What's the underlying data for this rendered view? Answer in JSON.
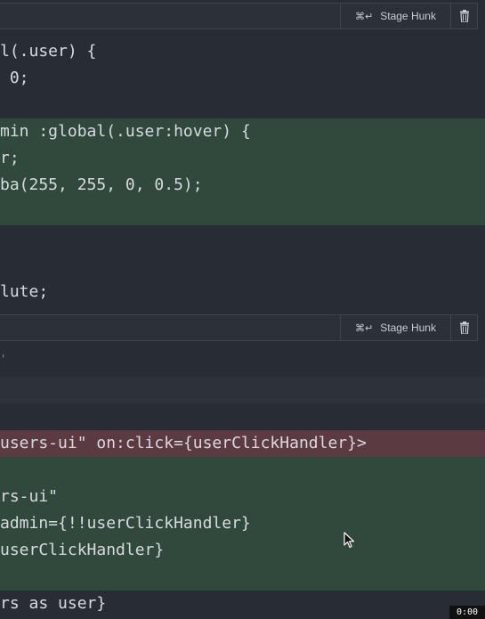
{
  "hunks": [
    {
      "stage_label": "Stage Hunk",
      "shortcut": "⌘↵"
    },
    {
      "stage_label": "Stage Hunk",
      "shortcut": "⌘↵"
    }
  ],
  "code_lines": [
    "l(.user) {",
    " 0;",
    "min :global(.user:hover) {",
    "r;",
    "ba(255, 255, 0, 0.5);",
    "lute;",
    "'",
    "users-ui\" on:click={userClickHandler}>",
    "rs-ui\"",
    "admin={!!userClickHandler}",
    "userClickHandler}",
    "rs as user}"
  ],
  "timestamp": "0:00"
}
